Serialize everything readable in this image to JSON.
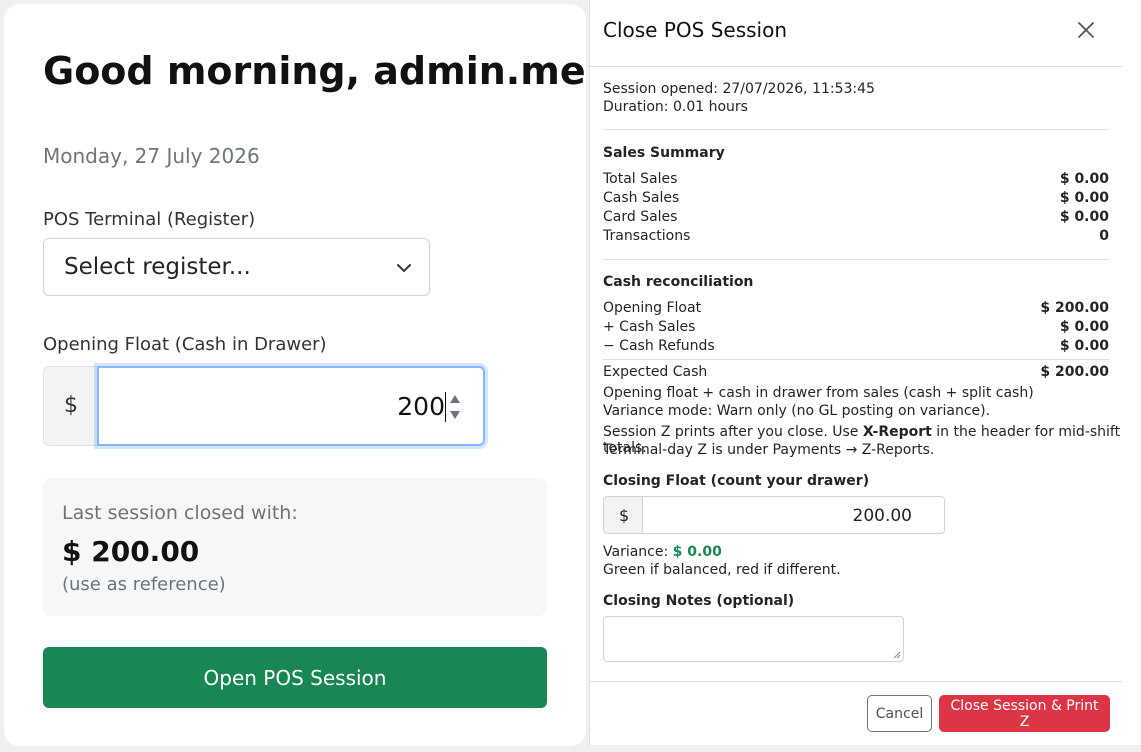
{
  "session_form": {
    "greeting": "Good morning, admin.meridian@biznsbook.com",
    "date": "Monday, 27 July 2026",
    "terminal_label": "POS Terminal (Register)",
    "terminal_select_value": "Select register...",
    "opening_float_label": "Opening Float (Cash in Drawer)",
    "currency_symbol": "$",
    "opening_float_value": "200",
    "last_session_title": "Last session closed with:",
    "last_session_amount": "$ 200.00",
    "last_session_note": "(use as reference)",
    "open_button": "Open POS Session"
  },
  "close_modal": {
    "title": "Close POS Session",
    "close_icon": "close-x-icon",
    "session_opened": "Session opened: 27/07/2026, 11:53:45",
    "duration": "Duration: 0.01 hours",
    "sales_summary": {
      "title": "Sales Summary",
      "rows": [
        {
          "label": "Total Sales",
          "value": "$ 0.00"
        },
        {
          "label": "Cash Sales",
          "value": "$ 0.00"
        },
        {
          "label": "Card Sales",
          "value": "$ 0.00"
        },
        {
          "label": "Transactions",
          "value": "0"
        }
      ]
    },
    "cash_reconciliation": {
      "title": "Cash reconciliation",
      "rows": [
        {
          "label": "Opening Float",
          "value": "$ 200.00"
        },
        {
          "label": "+ Cash Sales",
          "value": "$ 0.00"
        },
        {
          "label": "− Cash Refunds",
          "value": "$ 0.00"
        }
      ],
      "expected": {
        "label": "Expected Cash",
        "value": "$ 200.00"
      },
      "note_1": "Opening float + cash in drawer from sales (cash + split cash)",
      "note_2": "Variance mode: Warn only (no GL posting on variance).",
      "note_3_pre": "Session Z prints after you close. Use ",
      "note_3_bold": "X-Report",
      "note_3_post": " in the header for mid-shift totals.",
      "note_4": "Terminal-day Z is under Payments → Z-Reports."
    },
    "closing_float_label": "Closing Float (count your drawer)",
    "currency_symbol": "$",
    "closing_float_value": "200.00",
    "variance_label": "Variance: ",
    "variance_value": "$ 0.00",
    "variance_hint": "Green if balanced, red if different.",
    "closing_notes_label": "Closing Notes (optional)",
    "closing_notes_value": "",
    "cancel_button": "Cancel",
    "close_print_button": "Close Session & Print Z",
    "colors": {
      "success": "#198754",
      "danger": "#dc3545",
      "focus": "#86b7fe"
    }
  }
}
